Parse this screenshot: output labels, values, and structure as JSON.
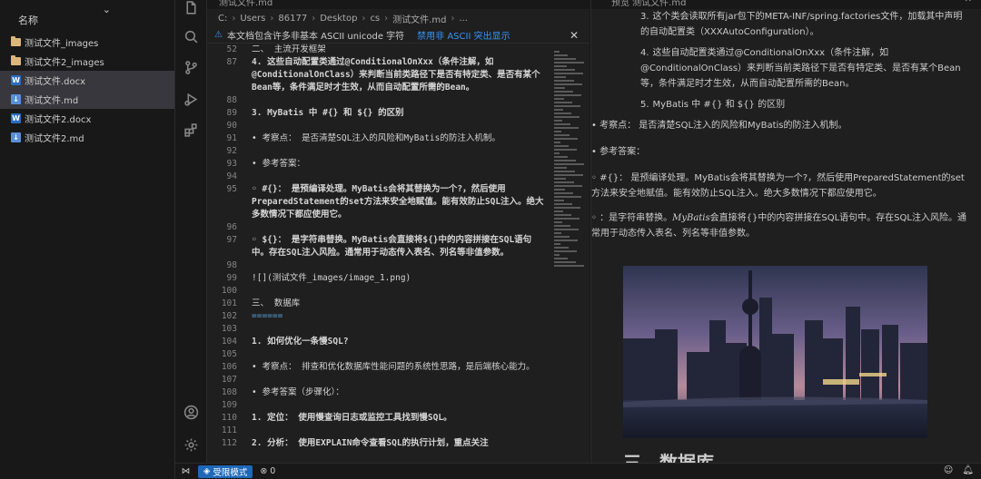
{
  "explorer": {
    "title": "名称",
    "files": [
      {
        "name": "测试文件_images",
        "type": "folder"
      },
      {
        "name": "测试文件2_images",
        "type": "folder"
      },
      {
        "name": "测试文件.docx",
        "type": "docx",
        "selected": true
      },
      {
        "name": "测试文件.md",
        "type": "md",
        "selected": true
      },
      {
        "name": "测试文件2.docx",
        "type": "docx"
      },
      {
        "name": "测试文件2.md",
        "type": "md"
      }
    ]
  },
  "activity_bar": {
    "icons": [
      "files-icon",
      "search-icon",
      "source-control-icon",
      "run-debug-icon",
      "extensions-icon",
      "account-icon",
      "settings-gear-icon"
    ]
  },
  "editor": {
    "tab_label": "测试文件.md",
    "breadcrumb": [
      "C:",
      "Users",
      "86177",
      "Desktop",
      "cs",
      "测试文件.md",
      "..."
    ],
    "warning": {
      "text": "本文档包含许多非基本 ASCII unicode 字符",
      "link": "禁用非 ASCII 突出显示",
      "close": "✕"
    },
    "lines": [
      {
        "n": "52",
        "t": "二、 主流开发框架",
        "k": "text"
      },
      {
        "n": "87",
        "t": "4. 这些自动配置类通过@ConditionalOnXxx（条件注解，如@ConditionalOnClass）来判断当前类路径下是否有特定类、是否有某个Bean等，条件满足时才生效，从而自动配置所需的Bean。",
        "k": "numbered"
      },
      {
        "n": "88",
        "t": "",
        "k": "blank"
      },
      {
        "n": "89",
        "t": "3. MyBatis 中 #{} 和 ${} 的区别",
        "k": "numbered"
      },
      {
        "n": "90",
        "t": "",
        "k": "blank"
      },
      {
        "n": "91",
        "t": "• 考察点： 是否清楚SQL注入的风险和MyBatis的防注入机制。",
        "k": "text"
      },
      {
        "n": "92",
        "t": "",
        "k": "blank"
      },
      {
        "n": "93",
        "t": "• 参考答案：",
        "k": "text"
      },
      {
        "n": "94",
        "t": "",
        "k": "blank"
      },
      {
        "n": "95",
        "t": "◦ #{}： 是预编译处理。MyBatis会将其替换为一个?，然后使用PreparedStatement的set方法来安全地赋值。能有效防止SQL注入。绝大多数情况下都应使用它。",
        "k": "bold"
      },
      {
        "n": "96",
        "t": "",
        "k": "blank"
      },
      {
        "n": "97",
        "t": "◦ ${}： 是字符串替换。MyBatis会直接将${}中的内容拼接在SQL语句中。存在SQL注入风险。通常用于动态传入表名、列名等非值参数。",
        "k": "bold"
      },
      {
        "n": "98",
        "t": "",
        "k": "blank"
      },
      {
        "n": "99",
        "t": "![](测试文件_images/image_1.png)",
        "k": "text"
      },
      {
        "n": "100",
        "t": "",
        "k": "blank"
      },
      {
        "n": "101",
        "t": "三、 数据库",
        "k": "text"
      },
      {
        "n": "102",
        "t": "======",
        "k": "hr"
      },
      {
        "n": "103",
        "t": "",
        "k": "blank"
      },
      {
        "n": "104",
        "t": "1. 如何优化一条慢SQL?",
        "k": "numbered"
      },
      {
        "n": "105",
        "t": "",
        "k": "blank"
      },
      {
        "n": "106",
        "t": "• 考察点： 排查和优化数据库性能问题的系统性思路，是后端核心能力。",
        "k": "text"
      },
      {
        "n": "107",
        "t": "",
        "k": "blank"
      },
      {
        "n": "108",
        "t": "• 参考答案（步骤化）：",
        "k": "text"
      },
      {
        "n": "109",
        "t": "",
        "k": "blank"
      },
      {
        "n": "110",
        "t": "1. 定位： 使用慢查询日志或监控工具找到慢SQL。",
        "k": "numbered"
      },
      {
        "n": "111",
        "t": "",
        "k": "blank"
      },
      {
        "n": "112",
        "t": "2. 分析： 使用EXPLAIN命令查看SQL的执行计划，重点关注",
        "k": "numbered"
      }
    ]
  },
  "preview": {
    "tab_label": "预览 测试文件.md",
    "close": "✕",
    "list_items": [
      {
        "n": "3.",
        "t": "这个类会读取所有jar包下的META-INF/spring.factories文件，加载其中声明的自动配置类（XXXAutoConfiguration）。"
      },
      {
        "n": "4.",
        "t": "这些自动配置类通过@ConditionalOnXxx（条件注解，如@ConditionalOnClass）来判断当前类路径下是否有特定类、是否有某个Bean等，条件满足时才生效，从而自动配置所需的Bean。"
      },
      {
        "n": "5.",
        "t": "MyBatis 中 #{} 和 ${} 的区别"
      }
    ],
    "bullet1": "• 考察点： 是否清楚SQL注入的风险和MyBatis的防注入机制。",
    "bullet2": "• 参考答案：",
    "para1": "◦ #{}： 是预编译处理。MyBatis会将其替换为一个?，然后使用PreparedStatement的set方法来安全地赋值。能有效防止SQL注入。绝大多数情况下都应使用它。",
    "para2_prefix": "◦ ：是字符串替换。",
    "para2_math": "MyBatis",
    "para2_rest": "会直接将{}中的内容拼接在SQL语句中。存在SQL注入风险。通常用于动态传入表名、列名等非值参数。",
    "heading": "三、数据库"
  },
  "status_bar": {
    "remote_icon": "⋈",
    "restricted_mode": "受限模式",
    "errors": "⊗ 0",
    "right_icons": [
      "copilot-icon",
      "bell-icon"
    ]
  }
}
